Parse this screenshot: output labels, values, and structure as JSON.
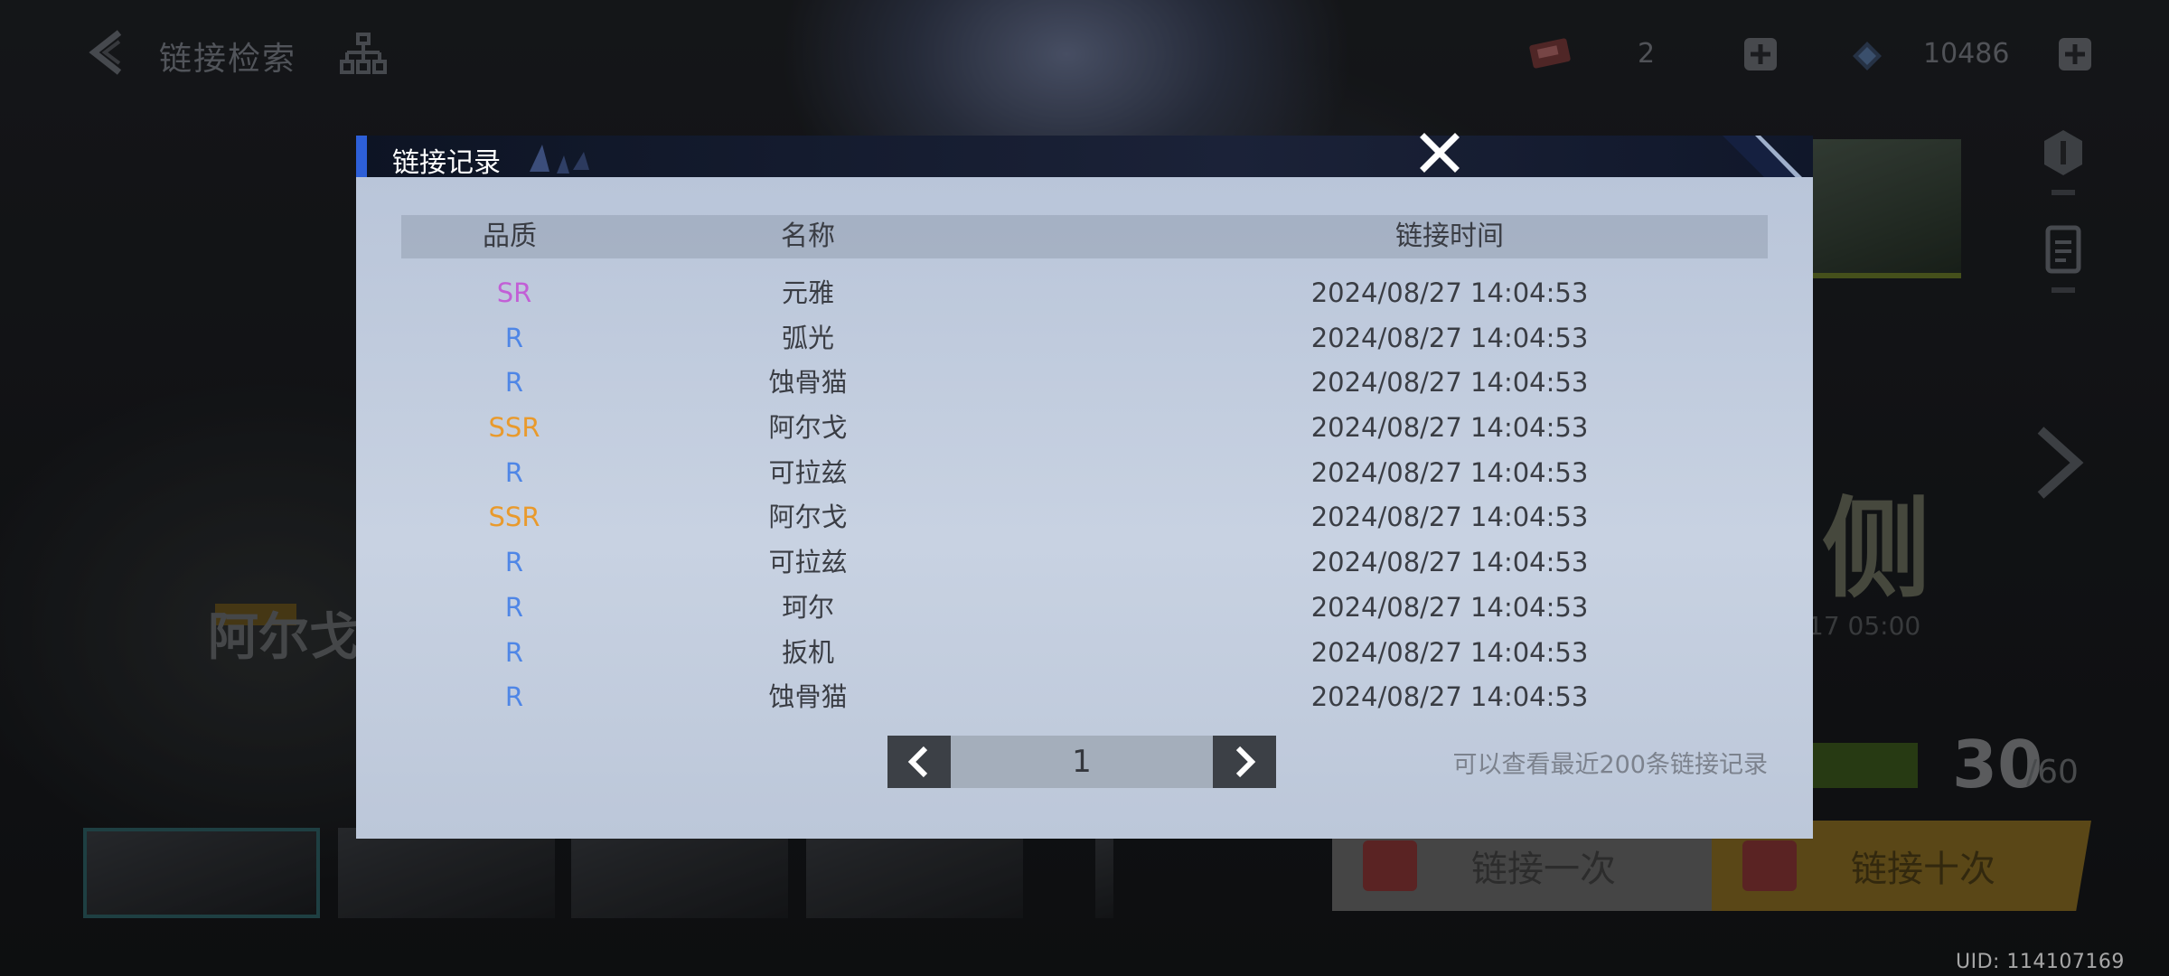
{
  "hud": {
    "title": "链接检索",
    "ticket_count": "2",
    "gem_count": "10486",
    "promo_title": "阿尔戈",
    "event_big_char": "侧",
    "event_date": "17 05:00",
    "pull_counter": "30",
    "pull_max": "/60",
    "pull_once_label": "链接一次",
    "pull_ten_label": "链接十次",
    "uid": "UID: 114107169"
  },
  "modal": {
    "title": "链接记录",
    "columns": {
      "quality": "品质",
      "name": "名称",
      "time": "链接时间"
    },
    "rows": [
      {
        "quality": "SR",
        "name": "元雅",
        "time": "2024/08/27 14:04:53"
      },
      {
        "quality": "R",
        "name": "弧光",
        "time": "2024/08/27 14:04:53"
      },
      {
        "quality": "R",
        "name": "蚀骨猫",
        "time": "2024/08/27 14:04:53"
      },
      {
        "quality": "SSR",
        "name": "阿尔戈",
        "time": "2024/08/27 14:04:53"
      },
      {
        "quality": "R",
        "name": "可拉兹",
        "time": "2024/08/27 14:04:53"
      },
      {
        "quality": "SSR",
        "name": "阿尔戈",
        "time": "2024/08/27 14:04:53"
      },
      {
        "quality": "R",
        "name": "可拉兹",
        "time": "2024/08/27 14:04:53"
      },
      {
        "quality": "R",
        "name": "珂尔",
        "time": "2024/08/27 14:04:53"
      },
      {
        "quality": "R",
        "name": "扳机",
        "time": "2024/08/27 14:04:53"
      },
      {
        "quality": "R",
        "name": "蚀骨猫",
        "time": "2024/08/27 14:04:53"
      }
    ],
    "page": "1",
    "hint": "可以查看最近200条链接记录"
  },
  "colors": {
    "SSR": "#e99a2c",
    "SR": "#c25fd6",
    "R": "#4f86e6",
    "accent": "#2d5fd8"
  },
  "icons": {
    "back": "back-arrow-icon",
    "tree": "hierarchy-icon",
    "close": "close-icon",
    "prev": "chevron-left-icon",
    "next": "chevron-right-icon"
  }
}
